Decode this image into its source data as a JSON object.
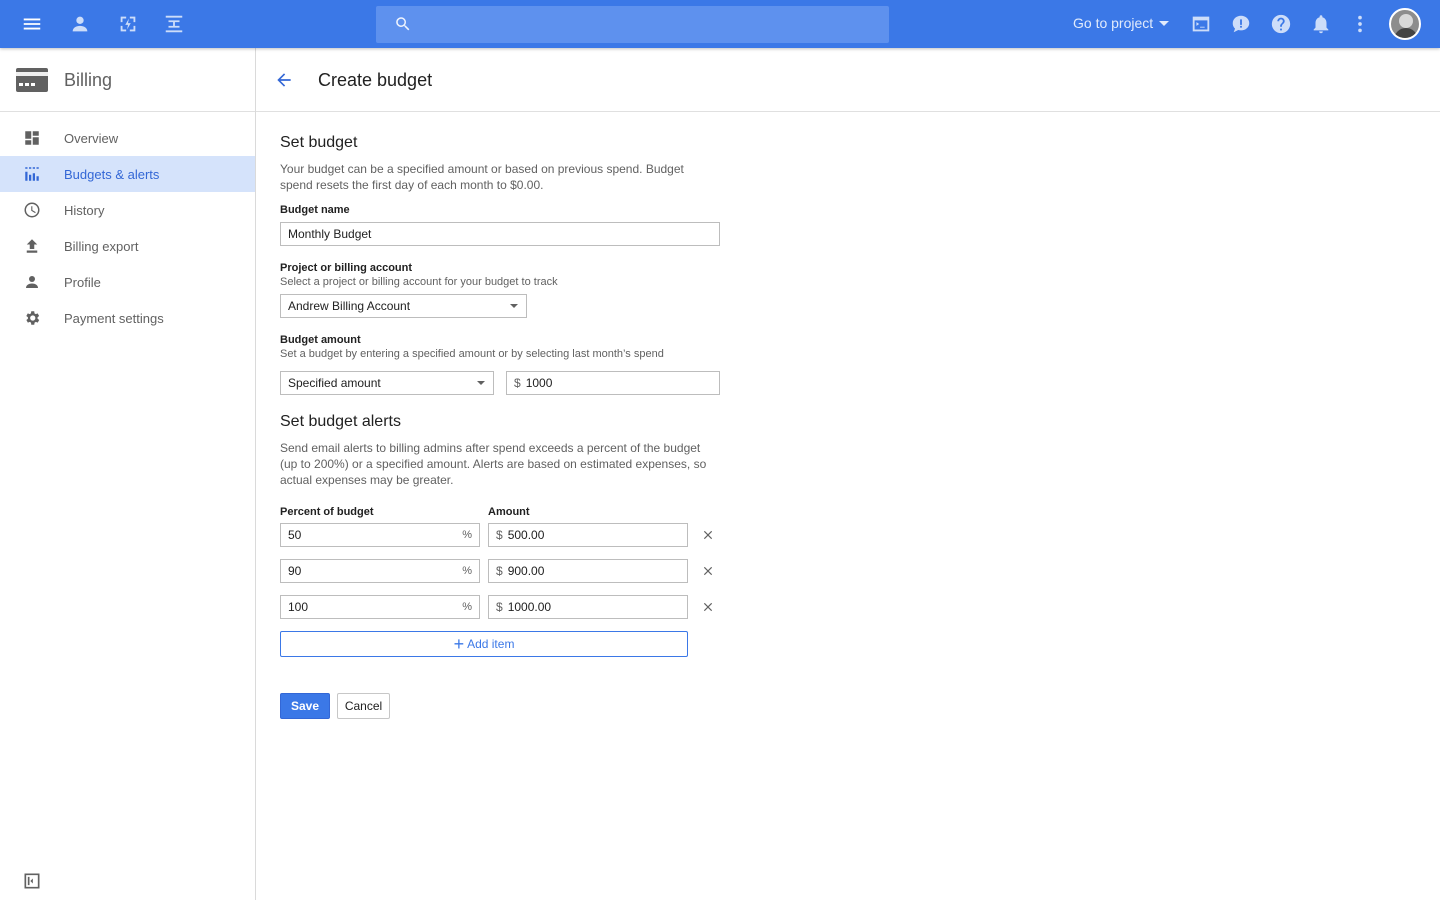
{
  "topbar": {
    "search_placeholder": "",
    "goto_label": "Go to project",
    "accent": "#3b78e7"
  },
  "sidebar": {
    "title": "Billing",
    "items": [
      {
        "label": "Overview",
        "icon": "dashboard-icon",
        "active": false
      },
      {
        "label": "Budgets & alerts",
        "icon": "budget-icon",
        "active": true
      },
      {
        "label": "History",
        "icon": "clock-icon",
        "active": false
      },
      {
        "label": "Billing export",
        "icon": "upload-icon",
        "active": false
      },
      {
        "label": "Profile",
        "icon": "person-icon",
        "active": false
      },
      {
        "label": "Payment settings",
        "icon": "gear-icon",
        "active": false
      }
    ]
  },
  "page": {
    "title": "Create budget"
  },
  "set_budget": {
    "title": "Set budget",
    "desc_line1": "Your budget can be a specified amount or based on previous spend. Budget",
    "desc_line2": "spend resets the first day of each month to $0.00.",
    "name_label": "Budget name",
    "name_value": "Monthly Budget",
    "account_label": "Project or billing account",
    "account_sublabel": "Select a project or billing account for your budget to track",
    "account_value": "Andrew Billing Account",
    "amount_label": "Budget amount",
    "amount_sublabel": "Set a budget by entering a specified amount or by selecting last month’s spend",
    "amount_type": "Specified amount",
    "currency": "$",
    "amount_value": "1000"
  },
  "alerts": {
    "title": "Set budget alerts",
    "desc_line1": "Send email alerts to billing admins after spend exceeds a percent of the budget",
    "desc_line2": "(up to 200%) or a specified amount. Alerts are based on estimated expenses, so",
    "desc_line3": "actual expenses may be greater.",
    "percent_header": "Percent of budget",
    "amount_header": "Amount",
    "percent_suffix": "%",
    "currency": "$",
    "rows": [
      {
        "percent": "50",
        "amount": "500.00"
      },
      {
        "percent": "90",
        "amount": "900.00"
      },
      {
        "percent": "100",
        "amount": "1000.00"
      }
    ],
    "add_label": "Add item"
  },
  "actions": {
    "save": "Save",
    "cancel": "Cancel"
  }
}
